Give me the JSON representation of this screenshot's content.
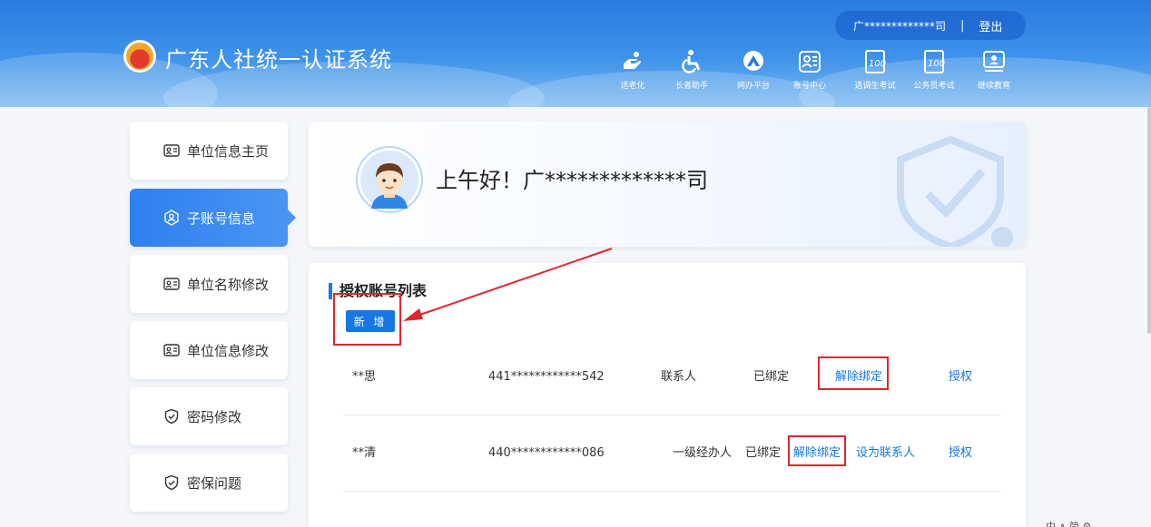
{
  "app": {
    "title": "广东人社统一认证系统"
  },
  "user": {
    "name": "广*************司",
    "separator": "|",
    "logout_label": "登出"
  },
  "nav": [
    {
      "label": "适老化",
      "icon": "elderly-care-icon"
    },
    {
      "label": "长者助手",
      "icon": "accessibility-icon"
    },
    {
      "label": "网办平台",
      "icon": "service-platform-icon"
    },
    {
      "label": "账号中心",
      "icon": "account-center-icon"
    },
    {
      "label": "选调生考试",
      "icon": "exam-icon"
    },
    {
      "label": "公务员考试",
      "icon": "exam-icon"
    },
    {
      "label": "继续教育",
      "icon": "education-icon"
    }
  ],
  "sidebar": {
    "items": [
      {
        "label": "单位信息主页",
        "icon": "id-card-icon",
        "active": false
      },
      {
        "label": "子账号信息",
        "icon": "sub-account-icon",
        "active": true
      },
      {
        "label": "单位名称修改",
        "icon": "id-card-icon",
        "active": false
      },
      {
        "label": "单位信息修改",
        "icon": "id-card-icon",
        "active": false
      },
      {
        "label": "密码修改",
        "icon": "shield-check-icon",
        "active": false
      },
      {
        "label": "密保问题",
        "icon": "shield-check-icon",
        "active": false
      }
    ]
  },
  "welcome": {
    "greeting": "上午好！广*************司"
  },
  "account_list": {
    "title": "授权账号列表",
    "add_label": "新 增",
    "rows": [
      {
        "name": "**思",
        "id": "441************542",
        "role": "联系人",
        "status": "已绑定",
        "unbind_label": "解除绑定",
        "set_contact_label": "",
        "auth_label": "授权"
      },
      {
        "name": "**清",
        "id": "440************086",
        "role": "一级经办人",
        "status": "已绑定",
        "unbind_label": "解除绑定",
        "set_contact_label": "设为联系人",
        "auth_label": "授权"
      }
    ]
  },
  "corner": {
    "text": "中 ∧ 简 ⚙"
  },
  "colors": {
    "primary": "#1677e5",
    "annotation_red": "#e0262c",
    "header_blue": "#2a7be0"
  }
}
